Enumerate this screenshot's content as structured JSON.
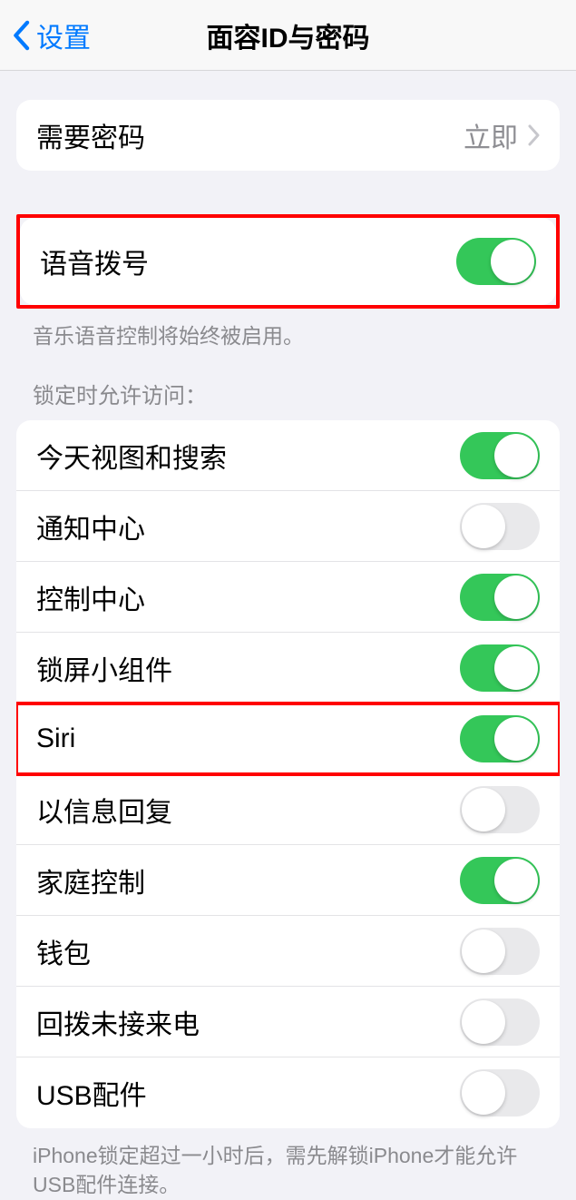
{
  "nav": {
    "back_label": "设置",
    "title": "面容ID与密码"
  },
  "require_passcode": {
    "label": "需要密码",
    "value": "立即"
  },
  "voice_dial": {
    "label": "语音拨号",
    "on": true,
    "footer": "音乐语音控制将始终被启用。"
  },
  "lock_access": {
    "header": "锁定时允许访问：",
    "items": [
      {
        "label": "今天视图和搜索",
        "on": true
      },
      {
        "label": "通知中心",
        "on": false
      },
      {
        "label": "控制中心",
        "on": true
      },
      {
        "label": "锁屏小组件",
        "on": true
      },
      {
        "label": "Siri",
        "on": true,
        "highlight": true
      },
      {
        "label": "以信息回复",
        "on": false
      },
      {
        "label": "家庭控制",
        "on": true
      },
      {
        "label": "钱包",
        "on": false
      },
      {
        "label": "回拨未接来电",
        "on": false
      },
      {
        "label": "USB配件",
        "on": false
      }
    ],
    "footer": "iPhone锁定超过一小时后，需先解锁iPhone才能允许USB配件连接。"
  },
  "colors": {
    "accent_blue": "#007aff",
    "toggle_green": "#34c759",
    "highlight_red": "#ff0000"
  }
}
